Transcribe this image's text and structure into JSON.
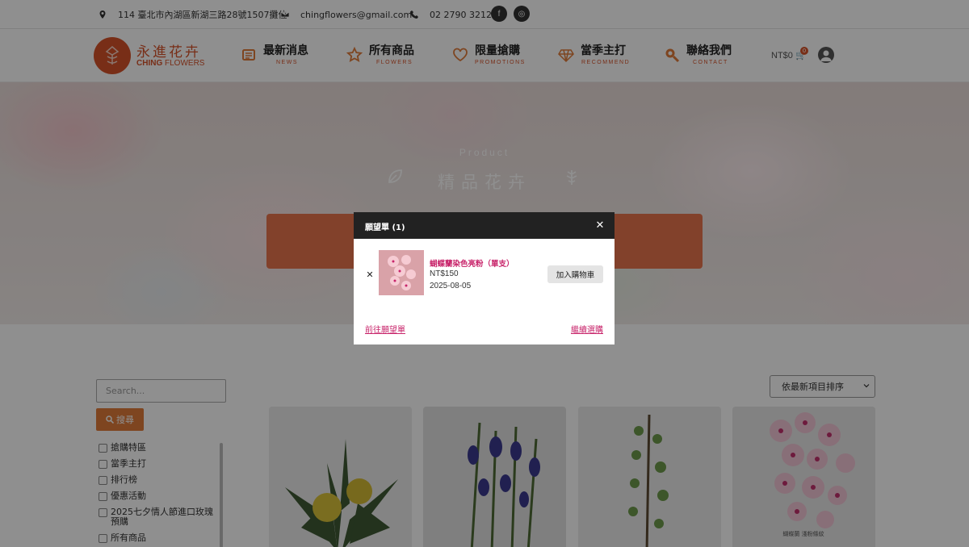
{
  "topbar": {
    "address": "114 臺北市內湖區新湖三路28號1507攤位",
    "email": "chingflowers@gmail.com",
    "phone": "02 2790 3212",
    "social": [
      {
        "icon": "facebook-icon",
        "glyph": "f"
      },
      {
        "icon": "instagram-icon",
        "glyph": "◎"
      }
    ]
  },
  "brand": {
    "name_cn": "永進花卉",
    "name_en_bold": "CHING",
    "name_en_rest": " FLOWERS",
    "color": "#d6522a"
  },
  "nav": [
    {
      "label": "最新消息",
      "sub": "NEWS",
      "icon": "newspaper-icon"
    },
    {
      "label": "所有商品",
      "sub": "FLOWERS",
      "icon": "star-icon"
    },
    {
      "label": "限量搶購",
      "sub": "PROMOTIONS",
      "icon": "heart-icon"
    },
    {
      "label": "當季主打",
      "sub": "RECOMMEND",
      "icon": "diamond-icon"
    },
    {
      "label": "聯絡我們",
      "sub": "CONTACT",
      "icon": "search-icon"
    }
  ],
  "cart": {
    "total": "NT$0",
    "count": "0"
  },
  "hero": {
    "subtitle": "Product",
    "title": "精品花卉"
  },
  "sidebar": {
    "search_placeholder": "Search...",
    "search_button": "搜尋",
    "categories": [
      "搶購特區",
      "當季主打",
      "排行榜",
      "優惠活動",
      "2025七夕情人節進口玫瑰預購",
      "所有商品"
    ]
  },
  "sort": {
    "selected": "依最新項目排序"
  },
  "products": [
    {
      "name": "product-card-1"
    },
    {
      "name": "product-card-2"
    },
    {
      "name": "product-card-3"
    },
    {
      "name": "product-card-4",
      "overlay_text": "蝴蝶蘭 淺粉條紋"
    }
  ],
  "wishlist_modal": {
    "title": "願望單 (1)",
    "close": "✕",
    "item": {
      "remove": "✕",
      "name": "蝴蝶蘭染色亮粉（單支）",
      "price": "NT$150",
      "date": "2025-08-05",
      "add_to_cart": "加入購物車"
    },
    "link_wishlist": "前往願望單",
    "link_continue": "繼續選購"
  },
  "colors": {
    "accent": "#d6522a",
    "button": "#e07b39",
    "link": "#c8256b",
    "modal_header": "#222222"
  }
}
